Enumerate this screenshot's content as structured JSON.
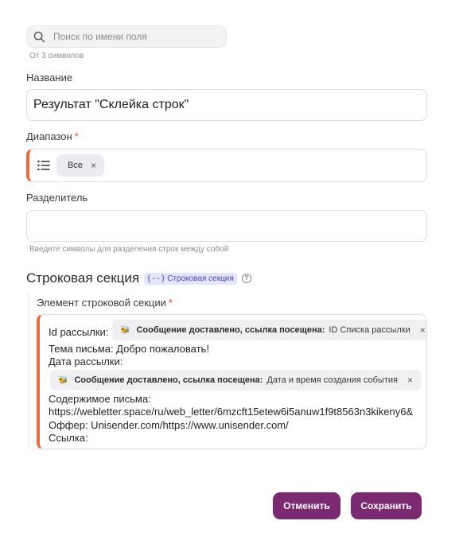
{
  "search": {
    "placeholder": "Поиск по имени поля",
    "hint": "От 3 символов"
  },
  "name_field": {
    "label": "Название",
    "value": "Результат \"Склейка строк\""
  },
  "range_field": {
    "label": "Диапазон",
    "required_mark": "*",
    "chip": "Все"
  },
  "separator_field": {
    "label": "Разделитель",
    "hint": "Введите символы для разделения строк между собой",
    "value": ""
  },
  "row_section": {
    "title": "Строковая секция",
    "badge": "Строковая секция",
    "badge_prefix": "{--}",
    "help_icon": "?",
    "element": {
      "label": "Элемент строковой секции",
      "required_mark": "*",
      "line1_prefix": "Id рассылки:",
      "tag1": {
        "event": "Сообщение доставлено, ссылка посещена:",
        "value": "ID Списка рассылки"
      },
      "line_subject": "Тема письма: Добро пожаловать!",
      "line_date": "Дата рассылки:",
      "tag2": {
        "event": "Сообщение доставлено, ссылка посещена:",
        "value": "Дата и время создания события"
      },
      "line_content": "Содержимое письма:",
      "line_url": "https://webletter.space/ru/web_letter/6mzcft15etew6i5anuw1f9t8563n3kikeny6&",
      "line_offer": "Оффер: Unisender.com/https://www.unisender.com/",
      "line_link": "Ссылка:"
    }
  },
  "icons": {
    "chip_close": "×",
    "event_icon": "🐝"
  },
  "buttons": {
    "cancel": "Отменить",
    "save": "Сохранить"
  },
  "colors": {
    "accent": "#7b2a71",
    "error": "#f06a3a",
    "badge_bg": "#e4e4fb"
  }
}
